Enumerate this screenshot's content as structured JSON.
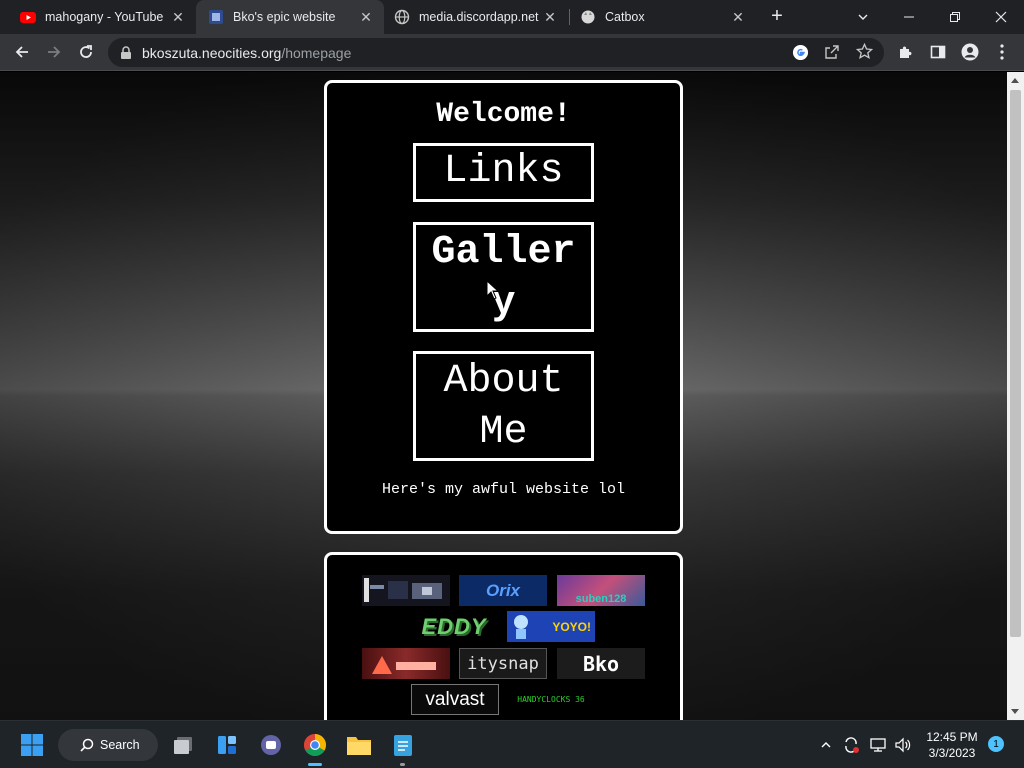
{
  "browser": {
    "tabs": [
      {
        "title": "mahogany - YouTube",
        "icon": "youtube-icon",
        "active": false
      },
      {
        "title": "Bko's epic website",
        "icon": "site-favicon-icon",
        "active": true
      },
      {
        "title": "media.discordapp.net",
        "icon": "globe-icon",
        "active": false
      },
      {
        "title": "Catbox",
        "icon": "catbox-icon",
        "active": false
      }
    ],
    "close_glyph": "✕",
    "new_tab_glyph": "+",
    "url": {
      "host": "bkoszuta.neocities.org",
      "path": "/homepage"
    }
  },
  "page": {
    "welcome": "Welcome!",
    "nav": {
      "links": "Links",
      "gallery_line1": "Galler",
      "gallery_line2": "y",
      "about_line1": "About",
      "about_line2": "Me"
    },
    "tagline": "Here's my awful website lol",
    "badges": [
      {
        "text": "",
        "name": "badge-pixel",
        "bg": "#1a1a2a"
      },
      {
        "text": "Orix",
        "name": "badge-orix",
        "bg": "#0b2a66",
        "color": "#58a0ff"
      },
      {
        "text": "suben128",
        "name": "badge-suben128",
        "bg": "#5a3a8a",
        "color": "#2ad0c0"
      },
      {
        "text": "EDDY",
        "name": "badge-eddy",
        "bg": "#000000",
        "color": "#5fbf5f"
      },
      {
        "text": "YOYO!",
        "name": "badge-yoyo",
        "bg": "#1e43b4",
        "color": "#ffd400"
      },
      {
        "text": "",
        "name": "badge-red",
        "bg": "#5a1a1a"
      },
      {
        "text": "itysnap",
        "name": "badge-citysnap",
        "bg": "#1a1a1a",
        "color": "#e0e0e0"
      },
      {
        "text": "Bko",
        "name": "badge-bko",
        "bg": "#1c1c1c",
        "color": "#ffffff"
      },
      {
        "text": "valvast",
        "name": "badge-valvast",
        "bg": "#0a0a0a",
        "color": "#ffffff"
      },
      {
        "text": "HANDYCLOCKS 36",
        "name": "badge-handyclocks",
        "bg": "#000000",
        "color": "#2bd02b"
      }
    ]
  },
  "taskbar": {
    "search_label": "Search",
    "time": "12:45 PM",
    "date": "3/3/2023",
    "notification_count": "1"
  }
}
